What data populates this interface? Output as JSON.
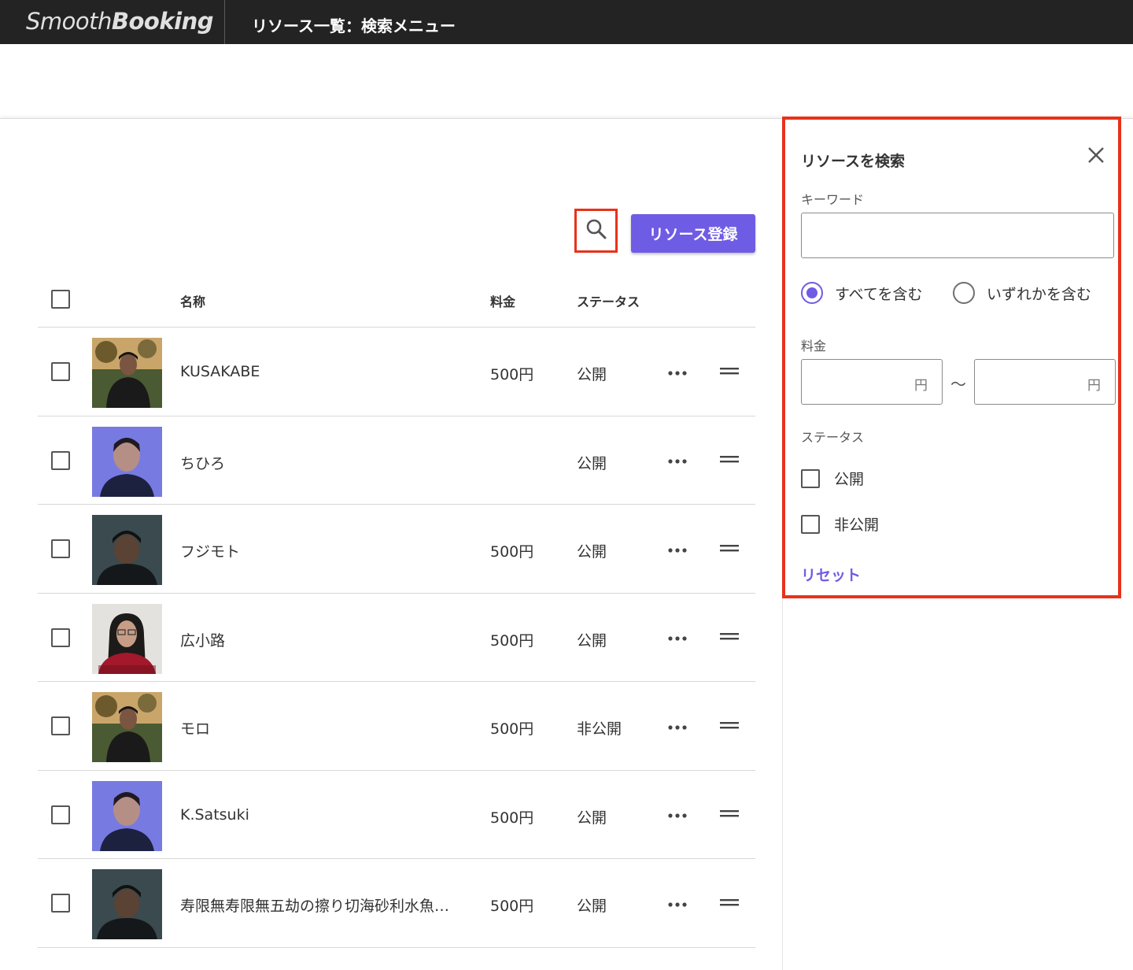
{
  "app": {
    "logo_light": "Smooth",
    "logo_bold": "Booking",
    "page_title": "リソース一覧：検索メニュー"
  },
  "toolbar": {
    "add_label": "リソース登録",
    "search_icon": "search-icon"
  },
  "table": {
    "headers": {
      "name": "名称",
      "fee": "料金",
      "status": "ステータス"
    },
    "rows": [
      {
        "name": "KUSAKABE",
        "fee": "500円",
        "status": "公開",
        "avatar": "outdoor"
      },
      {
        "name": "ちひろ",
        "fee": "",
        "status": "公開",
        "avatar": "purple"
      },
      {
        "name": "フジモト",
        "fee": "500円",
        "status": "公開",
        "avatar": "dark"
      },
      {
        "name": "広小路",
        "fee": "500円",
        "status": "公開",
        "avatar": "light"
      },
      {
        "name": "モロ",
        "fee": "500円",
        "status": "非公開",
        "avatar": "outdoor"
      },
      {
        "name": "K.Satsuki",
        "fee": "500円",
        "status": "公開",
        "avatar": "purple"
      },
      {
        "name": "寿限無寿限無五劫の擦り切海砂利水魚…",
        "fee": "500円",
        "status": "公開",
        "avatar": "dark"
      }
    ]
  },
  "search_panel": {
    "title": "リソースを検索",
    "keyword_label": "キーワード",
    "keyword_value": "",
    "match_options": [
      {
        "label": "すべてを含む",
        "checked": true
      },
      {
        "label": "いずれかを含む",
        "checked": false
      }
    ],
    "fee_label": "料金",
    "fee_min": "",
    "fee_max": "",
    "fee_unit": "円",
    "fee_separator": "〜",
    "status_label": "ステータス",
    "status_options": [
      {
        "label": "公開",
        "checked": false
      },
      {
        "label": "非公開",
        "checked": false
      }
    ],
    "reset_label": "リセット"
  },
  "colors": {
    "accent": "#6f5ce4",
    "highlight": "#e8321a",
    "topbar": "#232323"
  }
}
